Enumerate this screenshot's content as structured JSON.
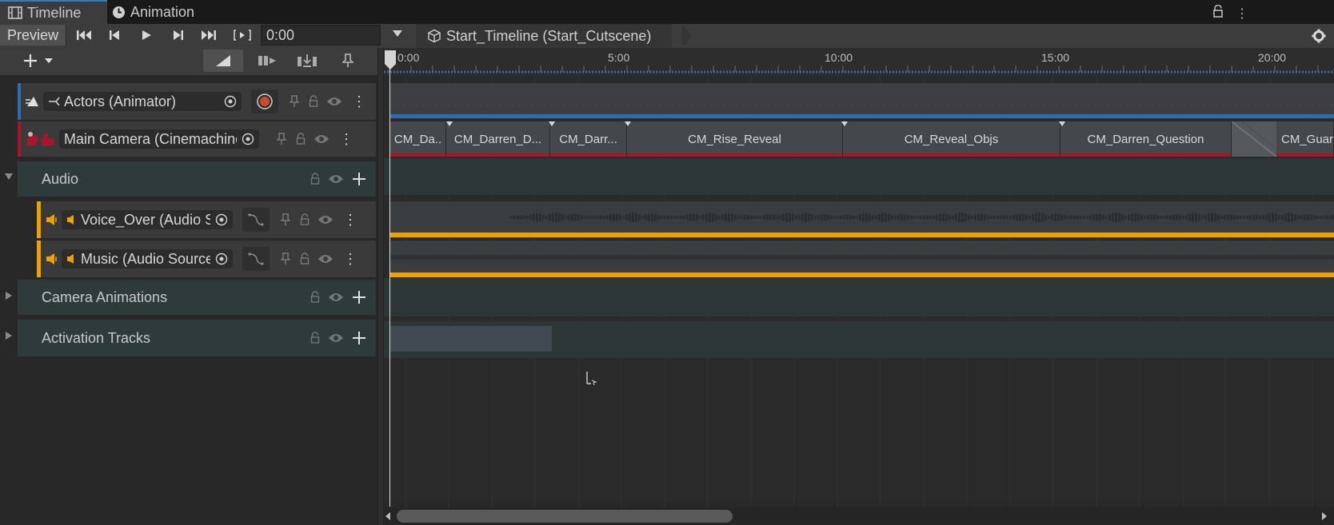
{
  "tabs": [
    {
      "label": "Timeline",
      "icon": "film-icon",
      "active": true
    },
    {
      "label": "Animation",
      "icon": "clock-icon",
      "active": false
    }
  ],
  "toolbar": {
    "preview_label": "Preview",
    "time_value": "0:00",
    "breadcrumb": "Start_Timeline (Start_Cutscene)"
  },
  "ruler": {
    "ticks": [
      "0:00",
      "5:00",
      "10:00",
      "15:00",
      "20:00"
    ]
  },
  "tracks": [
    {
      "name": "Actors (Animator)",
      "type": "animation-track"
    },
    {
      "name": "Main Camera (Cinemachine",
      "type": "cinemachine-track"
    },
    {
      "name": "Audio",
      "type": "group"
    },
    {
      "name": "Voice_Over (Audio S",
      "type": "audio-track"
    },
    {
      "name": "Music (Audio Source",
      "type": "audio-track"
    },
    {
      "name": "Camera Animations",
      "type": "group"
    },
    {
      "name": "Activation Tracks",
      "type": "group"
    }
  ],
  "camera_clips": [
    "CM_Da..",
    "CM_Darren_D...",
    "CM_Darr...",
    "CM_Rise_Reveal",
    "CM_Reveal_Objs",
    "CM_Darren_Question",
    "CM_Guar"
  ],
  "colors": {
    "animation_accent": "#2f6db3",
    "cinemachine_accent": "#a8162a",
    "audio_accent": "#f0a000",
    "tab_accent": "#3a79bb"
  }
}
